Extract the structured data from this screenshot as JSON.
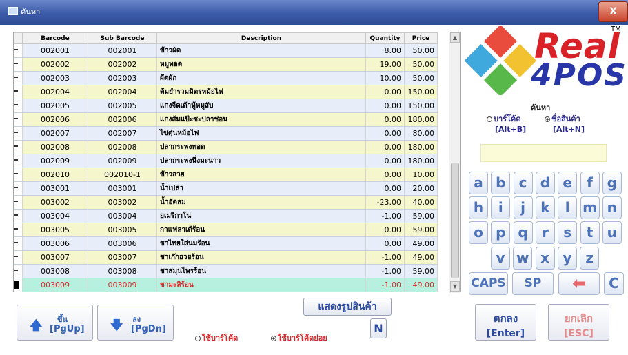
{
  "window": {
    "title": "ค้นหา",
    "close_label": "X"
  },
  "columns": {
    "barcode": "Barcode",
    "sub_barcode": "Sub Barcode",
    "description": "Description",
    "quantity": "Quantity",
    "price": "Price"
  },
  "rows": [
    {
      "barcode": "002001",
      "sub": "002001",
      "desc": "ข้าวผัด",
      "qty": "8.00",
      "price": "50.00"
    },
    {
      "barcode": "002002",
      "sub": "002002",
      "desc": "หมูทอด",
      "qty": "19.00",
      "price": "50.00"
    },
    {
      "barcode": "002003",
      "sub": "002003",
      "desc": "ผัดผัก",
      "qty": "10.00",
      "price": "50.00"
    },
    {
      "barcode": "002004",
      "sub": "002004",
      "desc": "ต้มยำรวมมิตรหม้อไฟ",
      "qty": "0.00",
      "price": "150.00"
    },
    {
      "barcode": "002005",
      "sub": "002005",
      "desc": "แกงจืดเต้าหู้หมูสับ",
      "qty": "0.00",
      "price": "150.00"
    },
    {
      "barcode": "002006",
      "sub": "002006",
      "desc": "แกงส้มแป๊ะซะปลาช่อน",
      "qty": "0.00",
      "price": "180.00"
    },
    {
      "barcode": "002007",
      "sub": "002007",
      "desc": "ไข่ตุ๋นหม้อไฟ",
      "qty": "0.00",
      "price": "80.00"
    },
    {
      "barcode": "002008",
      "sub": "002008",
      "desc": "ปลากระพงทอด",
      "qty": "0.00",
      "price": "180.00"
    },
    {
      "barcode": "002009",
      "sub": "002009",
      "desc": "ปลากระพงนึ่งมะนาว",
      "qty": "0.00",
      "price": "180.00"
    },
    {
      "barcode": "002010",
      "sub": "002010-1",
      "desc": "ข้าวสวย",
      "qty": "0.00",
      "price": "10.00"
    },
    {
      "barcode": "003001",
      "sub": "003001",
      "desc": "น้ำเปล่า",
      "qty": "0.00",
      "price": "20.00"
    },
    {
      "barcode": "003002",
      "sub": "003002",
      "desc": "น้ำอัดลม",
      "qty": "-23.00",
      "price": "40.00"
    },
    {
      "barcode": "003004",
      "sub": "003004",
      "desc": "อเมริกาโน่",
      "qty": "-1.00",
      "price": "59.00"
    },
    {
      "barcode": "003005",
      "sub": "003005",
      "desc": "กาแฟลาเต้ร้อน",
      "qty": "0.00",
      "price": "59.00"
    },
    {
      "barcode": "003006",
      "sub": "003006",
      "desc": "ชาไทยใส่นมร้อน",
      "qty": "0.00",
      "price": "49.00"
    },
    {
      "barcode": "003007",
      "sub": "003007",
      "desc": "ชาเก๊กฮวยร้อน",
      "qty": "-1.00",
      "price": "49.00"
    },
    {
      "barcode": "003008",
      "sub": "003008",
      "desc": "ชาสมุนไพรร้อน",
      "qty": "-1.00",
      "price": "59.00"
    },
    {
      "barcode": "003009",
      "sub": "003009",
      "desc": "ชามะลิร้อน",
      "qty": "-1.00",
      "price": "49.00"
    }
  ],
  "logo": {
    "line1": "Real",
    "line2": "4POS",
    "tm": "TM"
  },
  "search": {
    "label": "ค้นหา",
    "by_barcode": "บาร์โค้ด",
    "by_barcode_key": "[Alt+B]",
    "by_name": "ชื่อสินค้า",
    "by_name_key": "[Alt+N]",
    "selected": "name"
  },
  "keyboard": {
    "row1": [
      "a",
      "b",
      "c",
      "d",
      "e",
      "f",
      "g"
    ],
    "row2": [
      "h",
      "i",
      "j",
      "k",
      "l",
      "m",
      "n"
    ],
    "row3": [
      "o",
      "p",
      "q",
      "r",
      "s",
      "t",
      "u"
    ],
    "row4": [
      "v",
      "w",
      "x",
      "y",
      "z"
    ],
    "caps": "CAPS",
    "space": "SP",
    "backspace": "⬅",
    "clear": "C"
  },
  "buttons": {
    "up_top": "ขึ้น",
    "up_bot": "[PgUp]",
    "down_top": "ลง",
    "down_bot": "[PgDn]",
    "show_image": "แสดงรูปสินค้า",
    "n": "N",
    "use_barcode": "ใช้บาร์โค้ด",
    "use_sub_barcode": "ใช้บาร์โค้ดย่อย",
    "ok_l1": "ตกลง",
    "ok_l2": "[Enter]",
    "cancel_l1": "ยกเลิก",
    "cancel_l2": "[ESC]"
  },
  "colors": {
    "ok_text": "#2b4aa5",
    "cancel_text": "#e58a8a",
    "selected_row_text": "#d8262a"
  }
}
